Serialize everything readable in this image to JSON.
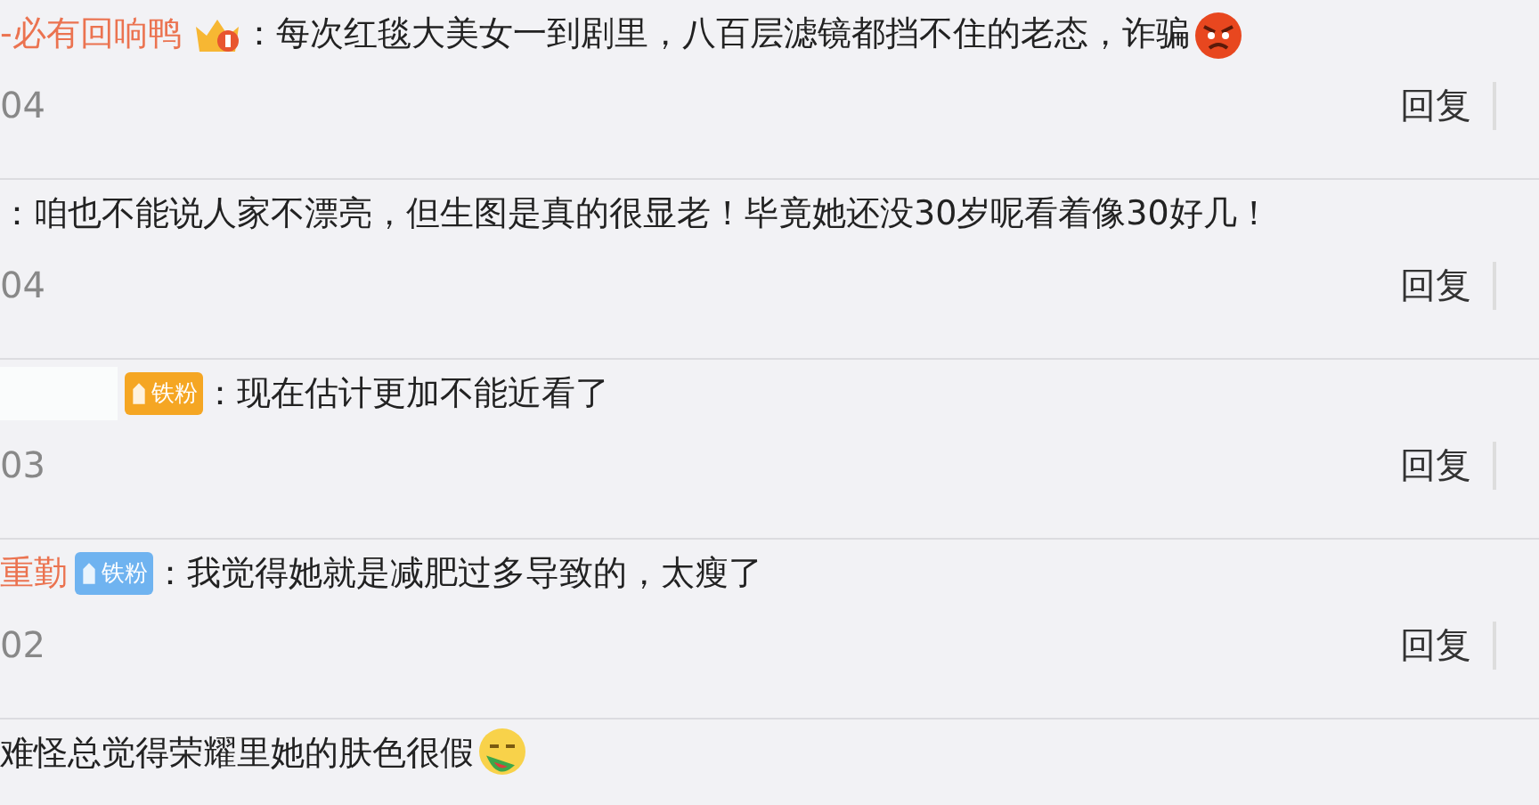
{
  "comments": [
    {
      "user": {
        "kind": "name",
        "name": "-必有回响鸭"
      },
      "badge": {
        "kind": "crown"
      },
      "separator": "：",
      "text": "每次红毯大美女一到剧里，八百层滤镜都挡不住的老态，诈骗",
      "emoji": {
        "kind": "angry"
      },
      "date": "04",
      "reply": "回复"
    },
    {
      "separator": "：",
      "text": "咱也不能说人家不漂亮，但生图是真的很显老！毕竟她还没30岁呢看着像30好几！",
      "date": "04",
      "reply": "回复"
    },
    {
      "user": {
        "kind": "hidden"
      },
      "badge": {
        "kind": "fan",
        "label": "铁粉",
        "color": "#f5a623"
      },
      "separator": "：",
      "text": "现在估计更加不能近看了",
      "date": "03",
      "reply": "回复"
    },
    {
      "user": {
        "kind": "name",
        "name": "重勤"
      },
      "badge": {
        "kind": "fan",
        "label": "铁粉",
        "color": "#6fb3f0"
      },
      "separator": "：",
      "text": "我觉得她就是减肥过多导致的，太瘦了",
      "date": "02",
      "reply": "回复"
    },
    {
      "text": "难怪总觉得荣耀里她的肤色很假",
      "emoji": {
        "kind": "watermelon"
      }
    }
  ]
}
